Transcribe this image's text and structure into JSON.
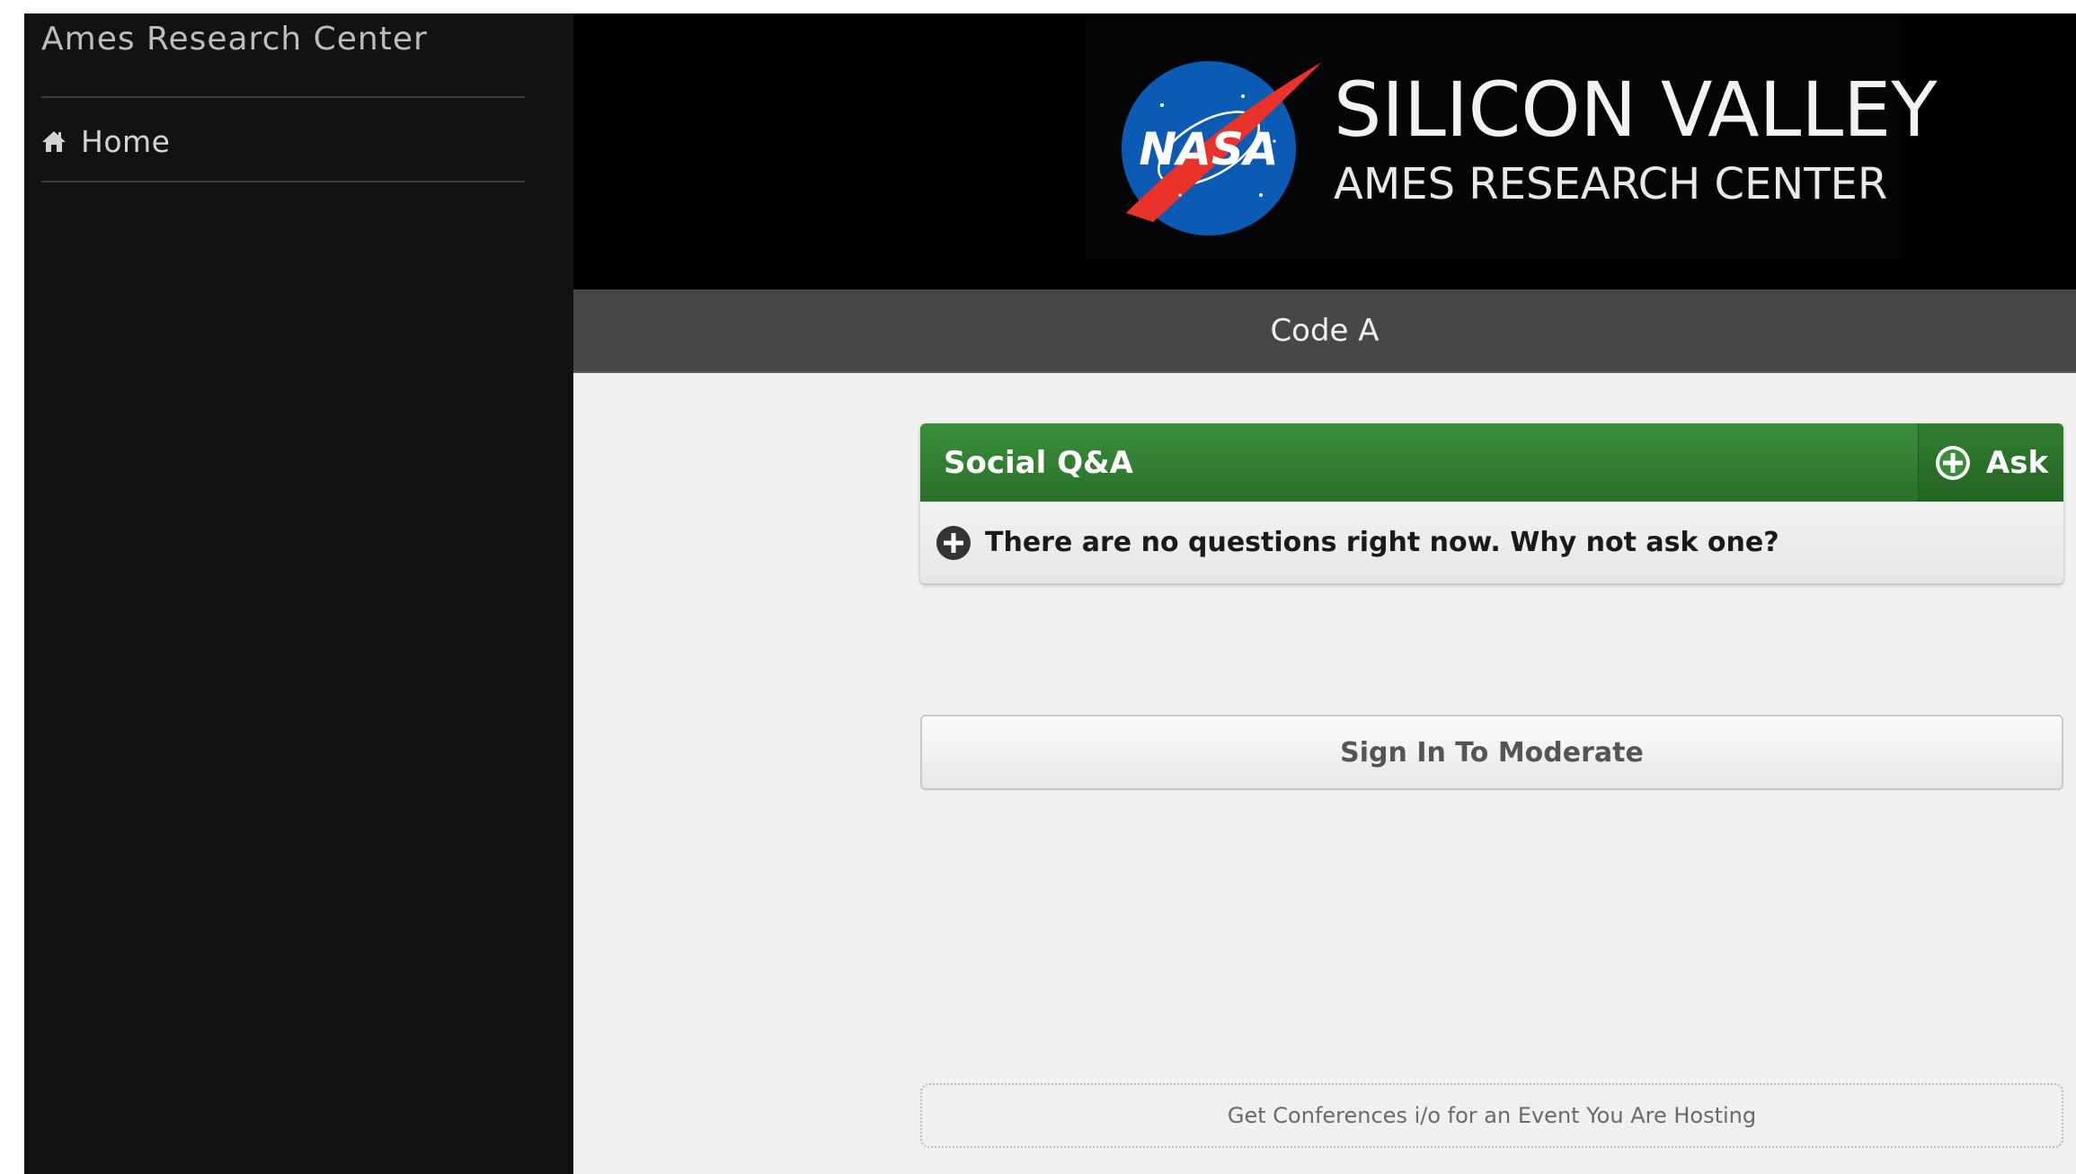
{
  "sidebar": {
    "title": "Ames Research Center",
    "items": [
      {
        "label": "Home",
        "icon": "home-icon"
      }
    ]
  },
  "header": {
    "logo": {
      "line1": "SILICON VALLEY",
      "line2": "AMES RESEARCH CENTER",
      "emblem_text": "NASA"
    }
  },
  "section": {
    "title": "Code A"
  },
  "qa": {
    "title": "Social Q&A",
    "ask_label": "Ask",
    "empty_message": "There are no questions right now. Why not ask one?"
  },
  "moderate": {
    "label": "Sign In To Moderate"
  },
  "footer": {
    "promo": "Get Conferences i/o for an Event You Are Hosting"
  },
  "colors": {
    "sidebar_bg": "#121212",
    "header_bg": "#000000",
    "section_bar_bg": "#474747",
    "qa_green": "#2f7f2f",
    "content_bg": "#f0f0f0",
    "nasa_blue": "#0b3d91",
    "nasa_red": "#fc3d21"
  }
}
